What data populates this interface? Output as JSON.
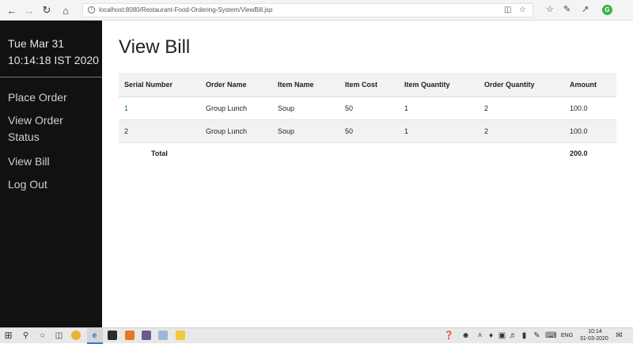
{
  "browser": {
    "url": "localhost:8080/Restaurant-Food-Ordering-System/ViewBill.jsp",
    "icons": [
      "back-icon",
      "forward-icon",
      "refresh-icon",
      "home-icon",
      "reading-view-icon",
      "favorite-star-icon",
      "favorites-bar-icon",
      "pen-icon",
      "share-icon"
    ],
    "profile_initial": "G",
    "profile_color": "#39b54a"
  },
  "sidebar": {
    "date": "Tue Mar 31",
    "time": "10:14:18 IST 2020",
    "links": [
      "Place Order",
      "View Order Status",
      "View Bill",
      "Log Out"
    ]
  },
  "main": {
    "title": "View Bill",
    "columns": [
      "Serial Number",
      "Order Name",
      "Item Name",
      "Item Cost",
      "Item Quantity",
      "Order Quantity",
      "Amount"
    ],
    "rows": [
      [
        "1",
        "Group Lunch",
        "Soup",
        "50",
        "1",
        "2",
        "100.0"
      ],
      [
        "2",
        "Group Lunch",
        "Soup",
        "50",
        "1",
        "2",
        "100.0"
      ]
    ],
    "total_label": "Total",
    "total_value": "200.0"
  },
  "taskbar": {
    "language": "ENG",
    "time": "10:14",
    "date": "31-03-2020"
  },
  "colors": {
    "sidebar_bg": "#111111",
    "link_green": "#1a7a2a",
    "table_stripe": "#f2f2f2"
  }
}
